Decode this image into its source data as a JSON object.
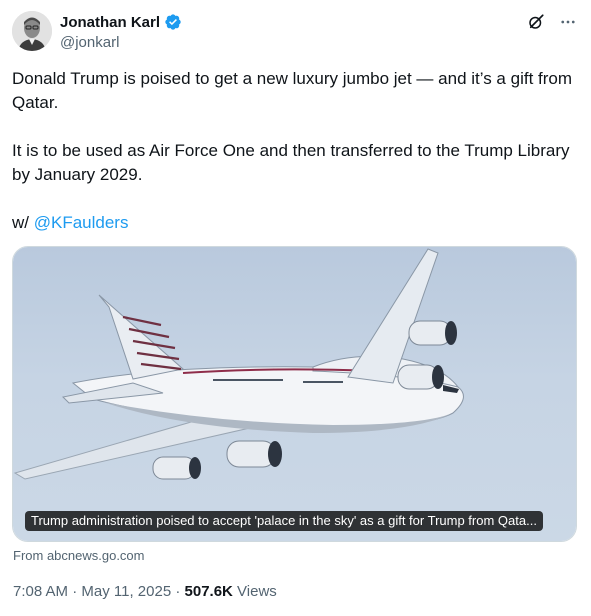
{
  "author": {
    "name": "Jonathan Karl",
    "handle": "@jonkarl",
    "verified": true
  },
  "icons": {
    "verified": "verified-badge-icon",
    "grok": "grok-icon",
    "more": "more-icon"
  },
  "tweet": {
    "line1": "Donald Trump is poised to get a new luxury jumbo jet — and it’s a gift from Qatar.",
    "line2": "It is to be used as Air Force One and then transferred to the Trump Library by January 2029.",
    "with_prefix": "w/ ",
    "mention": "@KFaulders"
  },
  "card": {
    "caption": "Trump administration poised to accept 'palace in the sky' as a gift for Trump from Qata...",
    "source": "From abcnews.go.com"
  },
  "meta": {
    "time": "7:08 AM",
    "sep1": " · ",
    "date": "May 11, 2025",
    "sep2": " · ",
    "views_count": "507.6K",
    "views_label": " Views"
  },
  "colors": {
    "accent": "#1d9bf0",
    "text": "#0f1419",
    "secondary": "#536471",
    "sky": "#c6d4e4"
  }
}
